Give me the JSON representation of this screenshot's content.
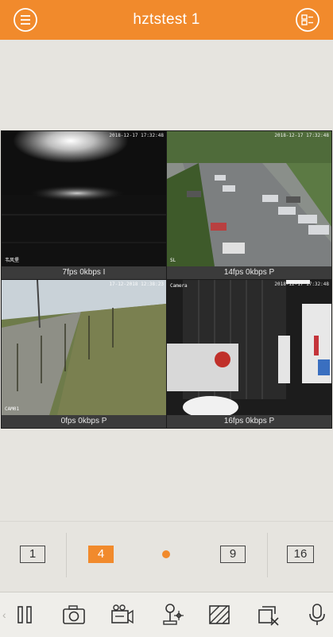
{
  "header": {
    "title": "hztstest 1",
    "menu_icon": "menu-icon",
    "channel_list_icon": "channel-list-icon"
  },
  "colors": {
    "accent": "#f18a2c",
    "background": "#e6e4df",
    "info_bar": "#3b3b3b"
  },
  "tiles": [
    {
      "info": "7fps 0kbps I",
      "timestamp": "2018-12-17 17:32:48",
      "cam_label": "韦风堡",
      "selected": true
    },
    {
      "info": "14fps 0kbps P",
      "timestamp": "2018-12-17 17:32:48",
      "cam_label": "SL",
      "selected": false
    },
    {
      "info": "0fps 0kbps P",
      "timestamp": "17-12-2018 12:38:23",
      "cam_label": "CAM01",
      "selected": false
    },
    {
      "info": "16fps 0kbps P",
      "timestamp": "2018-12-17 17:32:48",
      "cam_label": "Camera",
      "selected": false
    }
  ],
  "layout_options": [
    {
      "label": "1",
      "active": false
    },
    {
      "label": "4",
      "active": true
    },
    {
      "label": "9",
      "active": false
    },
    {
      "label": "16",
      "active": false
    }
  ],
  "toolbar": {
    "items": [
      "pause-icon",
      "snapshot-icon",
      "record-icon",
      "ptz-icon",
      "image-adjust-icon",
      "close-all-icon",
      "talk-icon"
    ],
    "left_arrow": "‹",
    "right_arrow": "›"
  }
}
